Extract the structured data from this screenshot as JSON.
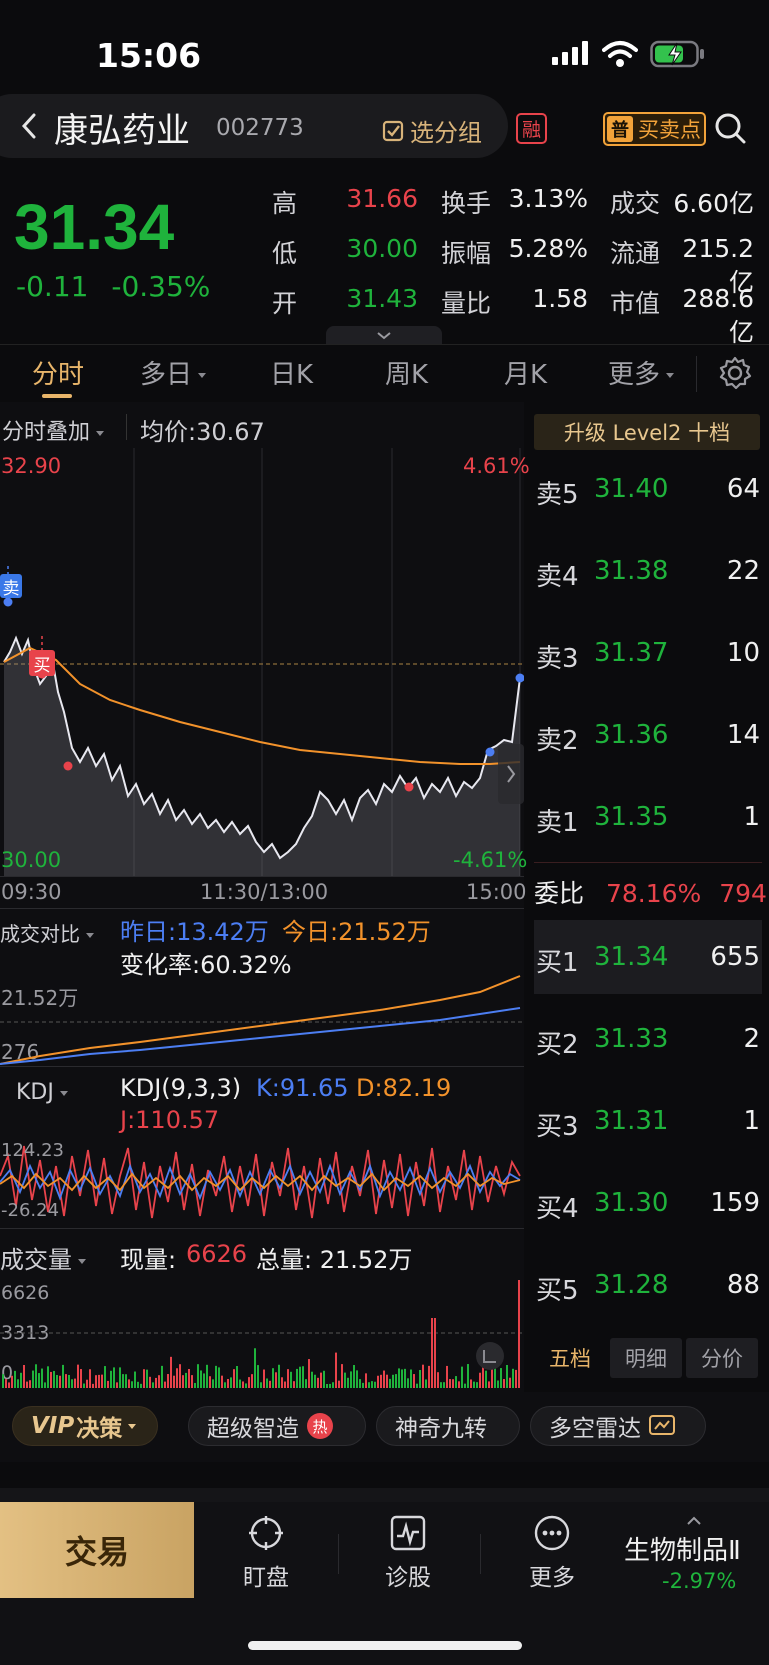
{
  "status_bar": {
    "time": "15:06"
  },
  "header": {
    "stock_name": "康弘药业",
    "stock_code": "002773",
    "group_button": "选分组",
    "margin_badge": "融",
    "buy_sell_badge": "普",
    "buy_sell_label": "买卖点"
  },
  "quote": {
    "price": "31.34",
    "change": "-0.11",
    "change_pct": "-0.35%",
    "rows": [
      {
        "label1": "高",
        "val1": "31.66",
        "label2": "换手",
        "val2": "3.13%",
        "label3": "成交",
        "val3": "6.60亿"
      },
      {
        "label1": "低",
        "val1": "30.00",
        "label2": "振幅",
        "val2": "5.28%",
        "label3": "流通",
        "val3": "215.2亿"
      },
      {
        "label1": "开",
        "val1": "31.43",
        "label2": "量比",
        "val2": "1.58",
        "label3": "市值",
        "val3": "288.6亿"
      }
    ]
  },
  "tabs": [
    "分时",
    "多日",
    "日K",
    "周K",
    "月K",
    "更多"
  ],
  "intraday": {
    "overlay_label": "分时叠加",
    "avg_price_label": "均价:30.67",
    "high_price": "32.90",
    "high_pct": "4.61%",
    "low_price": "30.00",
    "low_pct": "-4.61%",
    "time_start": "09:30",
    "time_mid": "11:30/13:00",
    "time_end": "15:00",
    "sell_marker": "卖",
    "buy_marker": "买"
  },
  "volume_compare": {
    "label": "成交对比",
    "yesterday": "昨日:13.42万",
    "today": "今日:21.52万",
    "change_rate": "变化率:60.32%",
    "axis_top": "21.52万",
    "axis_bottom": "276"
  },
  "kdj": {
    "label": "KDJ",
    "params": "KDJ(9,3,3)",
    "k": "K:91.65",
    "d": "D:82.19",
    "j": "J:110.57",
    "axis_top": "124.23",
    "axis_bottom": "-26.24"
  },
  "volume": {
    "label": "成交量",
    "current_label": "现量:",
    "current_value": "6626",
    "total": "总量: 21.52万",
    "axis_top": "6626",
    "axis_mid": "3313",
    "axis_bottom": "0"
  },
  "order_book": {
    "level2_banner": "升级 Level2 十档",
    "asks": [
      {
        "level": "卖5",
        "price": "31.40",
        "vol": "64"
      },
      {
        "level": "卖4",
        "price": "31.38",
        "vol": "22"
      },
      {
        "level": "卖3",
        "price": "31.37",
        "vol": "10"
      },
      {
        "level": "卖2",
        "price": "31.36",
        "vol": "14"
      },
      {
        "level": "卖1",
        "price": "31.35",
        "vol": "1"
      }
    ],
    "ratio_label": "委比",
    "ratio_pct": "78.16%",
    "ratio_vol": "794",
    "bids": [
      {
        "level": "买1",
        "price": "31.34",
        "vol": "655"
      },
      {
        "level": "买2",
        "price": "31.33",
        "vol": "2"
      },
      {
        "level": "买3",
        "price": "31.31",
        "vol": "1"
      },
      {
        "level": "买4",
        "price": "31.30",
        "vol": "159"
      },
      {
        "level": "买5",
        "price": "31.28",
        "vol": "88"
      }
    ],
    "tabs": [
      "五档",
      "明细",
      "分价"
    ]
  },
  "features": {
    "vip": "VIP",
    "vip_label": "决策",
    "super_smart": "超级智造",
    "hot_badge": "热",
    "nine_turns": "神奇九转",
    "radar": "多空雷达"
  },
  "bottom_nav": {
    "trade": "交易",
    "watch": "盯盘",
    "diagnose": "诊股",
    "more": "更多",
    "sector_name": "生物制品Ⅱ",
    "sector_change": "-2.97%"
  }
}
